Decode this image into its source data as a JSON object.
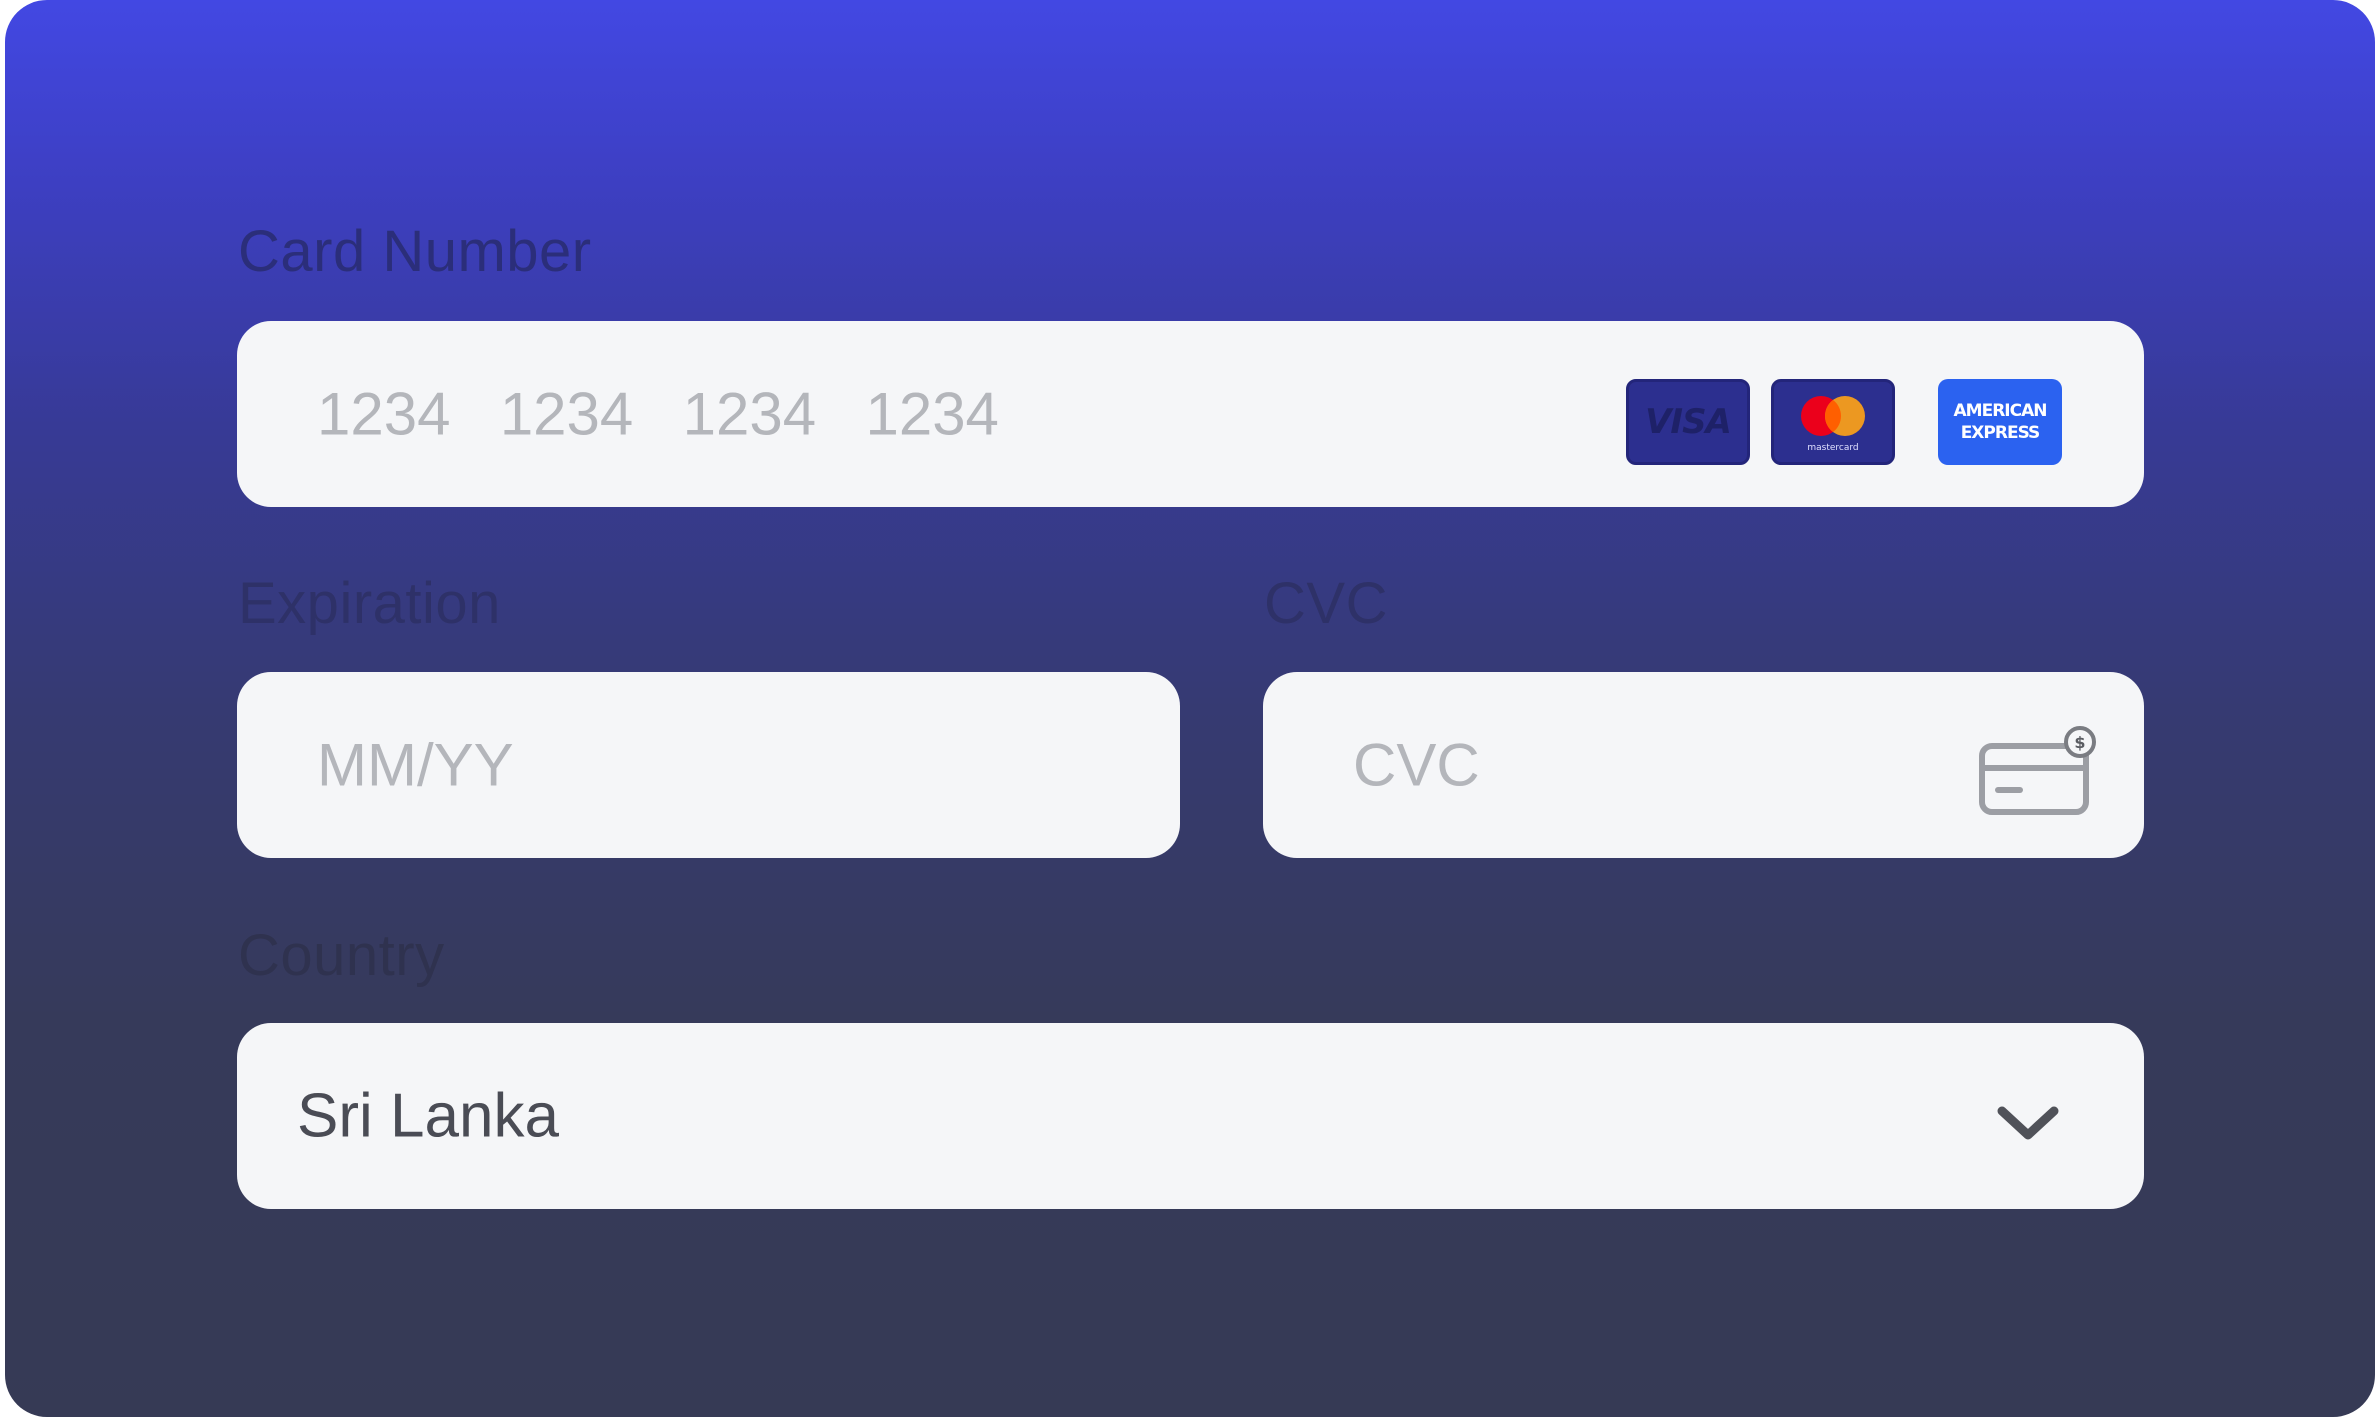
{
  "labels": {
    "card_number": "Card Number",
    "expiration": "Expiration",
    "cvc": "CVC",
    "country": "Country"
  },
  "card_number": {
    "placeholder": "1234  1234  1234  1234",
    "value": ""
  },
  "expiration": {
    "placeholder": "MM/YY",
    "value": ""
  },
  "cvc": {
    "placeholder": "CVC",
    "value": ""
  },
  "country": {
    "selected": "Sri Lanka"
  },
  "brands": {
    "visa": "VISA",
    "mastercard_caption": "mastercard",
    "amex_line1": "AMERICAN",
    "amex_line2": "EXPRESS"
  },
  "icons": {
    "visa": "visa-card-icon",
    "mastercard": "mastercard-icon",
    "amex": "american-express-icon",
    "cvc": "card-cvc-icon",
    "dropdown": "chevron-down-icon"
  },
  "colors": {
    "background_top": "#4248e3",
    "background_bottom": "#363a55",
    "field_background": "#f5f6f8",
    "placeholder_text": "#b4b6bb",
    "value_text": "#4a4c55",
    "mastercard_red": "#eb001b",
    "mastercard_orange": "#f79e1b",
    "amex_blue": "#2b62f0"
  }
}
